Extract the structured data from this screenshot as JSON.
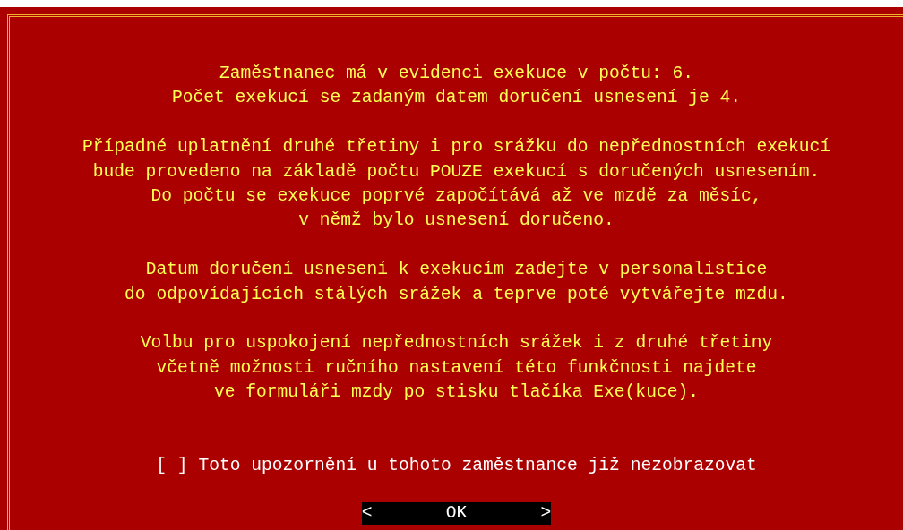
{
  "dialog": {
    "paragraphs": [
      {
        "lines": [
          "Zaměstnanec má v evidenci exekuce v počtu: 6.",
          "Počet exekucí se zadaným datem doručení usnesení je 4."
        ]
      },
      {
        "lines": [
          "Případné uplatnění druhé třetiny i pro srážku do nepřednostních exekucí",
          "bude provedeno na základě počtu POUZE exekucí s doručených usnesením.",
          "Do počtu se exekuce poprvé započítává až ve mzdě za měsíc,",
          "v němž bylo usnesení doručeno."
        ]
      },
      {
        "lines": [
          "Datum doručení usnesení k exekucím zadejte v personalistice",
          "do odpovídajících stálých srážek a teprve poté vytvářejte mzdu."
        ]
      },
      {
        "lines": [
          "Volbu pro uspokojení nepřednostních srážek i z druhé třetiny",
          "včetně možnosti ručního nastavení této funkčnosti najdete",
          "ve formuláři mzdy po stisku tlačíka Exe(kuce)."
        ]
      }
    ],
    "checkbox": {
      "mark": "[ ]",
      "label": "Toto upozornění u tohoto zaměstnance již nezobrazovat",
      "checked": false
    },
    "button": {
      "label": "<       OK       >",
      "selected": true
    }
  }
}
